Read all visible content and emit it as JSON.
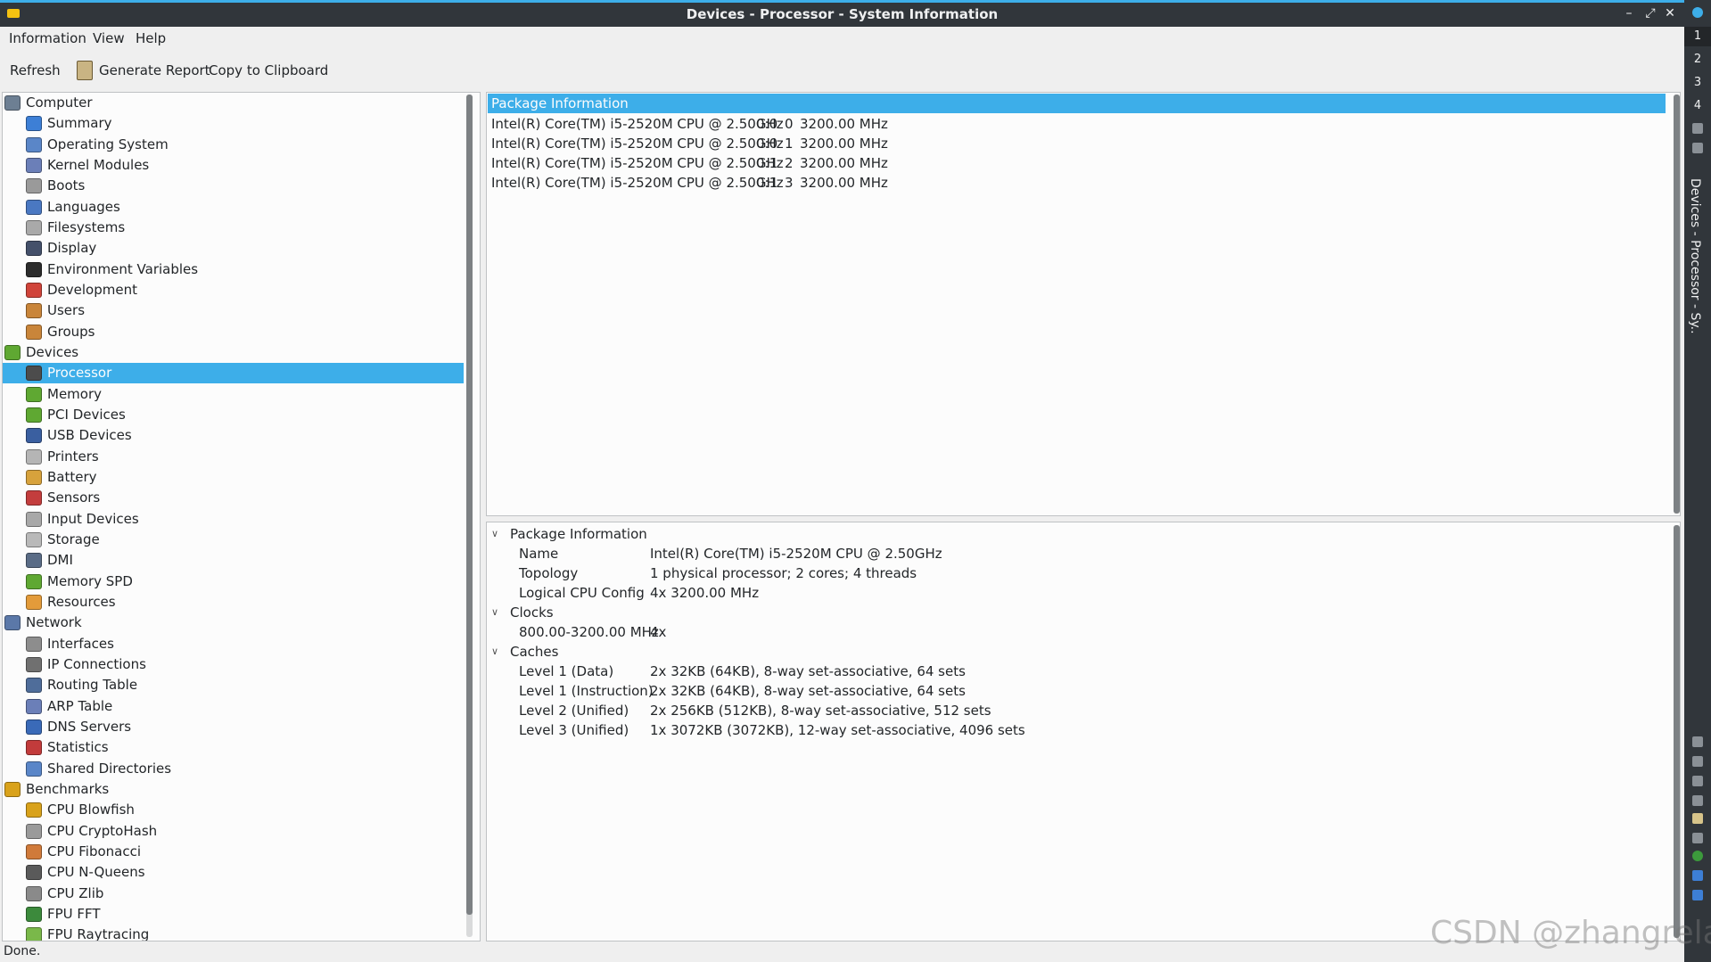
{
  "window": {
    "title": "Devices - Processor - System Information"
  },
  "panel": {
    "desktops": [
      "1",
      "2",
      "3",
      "4"
    ],
    "task_text": "Devices - Processor - Sy..."
  },
  "menu": {
    "items": [
      "Information",
      "View",
      "Help"
    ]
  },
  "toolbar": {
    "refresh": "Refresh",
    "report": "Generate Report",
    "copy": "Copy to Clipboard"
  },
  "tree": [
    {
      "label": "Computer",
      "level": 0,
      "icon": "computer-icon",
      "color": "#6d7f93"
    },
    {
      "label": "Summary",
      "level": 1,
      "icon": "info-icon",
      "color": "#3d7fd6"
    },
    {
      "label": "Operating System",
      "level": 1,
      "icon": "gear-icon",
      "color": "#5a86c8"
    },
    {
      "label": "Kernel Modules",
      "level": 1,
      "icon": "diamond-icon",
      "color": "#6b7fb8"
    },
    {
      "label": "Boots",
      "level": 1,
      "icon": "power-icon",
      "color": "#9a9a9a"
    },
    {
      "label": "Languages",
      "level": 1,
      "icon": "flag-icon",
      "color": "#4a78c2"
    },
    {
      "label": "Filesystems",
      "level": 1,
      "icon": "drive-icon",
      "color": "#a9a9a9"
    },
    {
      "label": "Display",
      "level": 1,
      "icon": "monitor-icon",
      "color": "#44506a"
    },
    {
      "label": "Environment Variables",
      "level": 1,
      "icon": "terminal-icon",
      "color": "#2c2c2c"
    },
    {
      "label": "Development",
      "level": 1,
      "icon": "toolbox-icon",
      "color": "#d0443a"
    },
    {
      "label": "Users",
      "level": 1,
      "icon": "user-icon",
      "color": "#c9853a"
    },
    {
      "label": "Groups",
      "level": 1,
      "icon": "users-icon",
      "color": "#c9853a"
    },
    {
      "label": "Devices",
      "level": 0,
      "icon": "board-icon",
      "color": "#5fa832"
    },
    {
      "label": "Processor",
      "level": 1,
      "icon": "cpu-icon",
      "color": "#4c4c4c",
      "selected": true
    },
    {
      "label": "Memory",
      "level": 1,
      "icon": "memory-icon",
      "color": "#5fa832"
    },
    {
      "label": "PCI Devices",
      "level": 1,
      "icon": "pci-icon",
      "color": "#5fa832"
    },
    {
      "label": "USB Devices",
      "level": 1,
      "icon": "usb-icon",
      "color": "#3a5fa0"
    },
    {
      "label": "Printers",
      "level": 1,
      "icon": "printer-icon",
      "color": "#b5b5b5"
    },
    {
      "label": "Battery",
      "level": 1,
      "icon": "battery-icon",
      "color": "#d7a23c"
    },
    {
      "label": "Sensors",
      "level": 1,
      "icon": "thermometer-icon",
      "color": "#c33d3d"
    },
    {
      "label": "Input Devices",
      "level": 1,
      "icon": "keyboard-icon",
      "color": "#a8a8a8"
    },
    {
      "label": "Storage",
      "level": 1,
      "icon": "storage-icon",
      "color": "#b9b9b9"
    },
    {
      "label": "DMI",
      "level": 1,
      "icon": "dmi-icon",
      "color": "#5a6c86"
    },
    {
      "label": "Memory SPD",
      "level": 1,
      "icon": "memory-spd-icon",
      "color": "#5fa832"
    },
    {
      "label": "Resources",
      "level": 1,
      "icon": "resources-icon",
      "color": "#e39b3a"
    },
    {
      "label": "Network",
      "level": 0,
      "icon": "network-icon",
      "color": "#5b78a8"
    },
    {
      "label": "Interfaces",
      "level": 1,
      "icon": "interfaces-icon",
      "color": "#8d8d8d"
    },
    {
      "label": "IP Connections",
      "level": 1,
      "icon": "ip-icon",
      "color": "#707070"
    },
    {
      "label": "Routing Table",
      "level": 1,
      "icon": "routing-icon",
      "color": "#4f6d9a"
    },
    {
      "label": "ARP Table",
      "level": 1,
      "icon": "arp-icon",
      "color": "#6b7fb8"
    },
    {
      "label": "DNS Servers",
      "level": 1,
      "icon": "globe-icon",
      "color": "#3a6ab8"
    },
    {
      "label": "Statistics",
      "level": 1,
      "icon": "stats-icon",
      "color": "#c23b3b"
    },
    {
      "label": "Shared Directories",
      "level": 1,
      "icon": "shared-icon",
      "color": "#5a86c8"
    },
    {
      "label": "Benchmarks",
      "level": 0,
      "icon": "benchmark-icon",
      "color": "#d9a21b"
    },
    {
      "label": "CPU Blowfish",
      "level": 1,
      "icon": "blowfish-icon",
      "color": "#d9a21b"
    },
    {
      "label": "CPU CryptoHash",
      "level": 1,
      "icon": "crypto-icon",
      "color": "#9a9a9a"
    },
    {
      "label": "CPU Fibonacci",
      "level": 1,
      "icon": "fibonacci-icon",
      "color": "#d07a3a"
    },
    {
      "label": "CPU N-Queens",
      "level": 1,
      "icon": "queens-icon",
      "color": "#5a5a5a"
    },
    {
      "label": "CPU Zlib",
      "level": 1,
      "icon": "zlib-icon",
      "color": "#8a8a8a"
    },
    {
      "label": "FPU FFT",
      "level": 1,
      "icon": "fft-icon",
      "color": "#3c8a3c"
    },
    {
      "label": "FPU Raytracing",
      "level": 1,
      "icon": "raytracing-icon",
      "color": "#7ab84a"
    }
  ],
  "top_list": {
    "header": "Package Information",
    "rows": [
      {
        "model": "Intel(R) Core(TM) i5-2520M CPU @ 2.50GHz",
        "topo": "0:0",
        "id": "0",
        "freq": "3200.00 MHz"
      },
      {
        "model": "Intel(R) Core(TM) i5-2520M CPU @ 2.50GHz",
        "topo": "0:0",
        "id": "1",
        "freq": "3200.00 MHz"
      },
      {
        "model": "Intel(R) Core(TM) i5-2520M CPU @ 2.50GHz",
        "topo": "0:1",
        "id": "2",
        "freq": "3200.00 MHz"
      },
      {
        "model": "Intel(R) Core(TM) i5-2520M CPU @ 2.50GHz",
        "topo": "0:1",
        "id": "3",
        "freq": "3200.00 MHz"
      }
    ]
  },
  "details": {
    "groups": [
      {
        "title": "Package Information",
        "rows": [
          {
            "key": "Name",
            "value": "Intel(R) Core(TM) i5-2520M CPU @ 2.50GHz"
          },
          {
            "key": "Topology",
            "value": "1 physical processor; 2 cores; 4 threads"
          },
          {
            "key": "Logical CPU Config",
            "value": "4x 3200.00 MHz"
          }
        ]
      },
      {
        "title": "Clocks",
        "rows": [
          {
            "key": "800.00-3200.00 MHz",
            "value": "4x"
          }
        ]
      },
      {
        "title": "Caches",
        "rows": [
          {
            "key": "Level 1 (Data)",
            "value": "2x 32KB (64KB), 8-way set-associative, 64 sets"
          },
          {
            "key": "Level 1 (Instruction)",
            "value": "2x 32KB (64KB), 8-way set-associative, 64 sets"
          },
          {
            "key": "Level 2 (Unified)",
            "value": "2x 256KB (512KB), 8-way set-associative, 512 sets"
          },
          {
            "key": "Level 3 (Unified)",
            "value": "1x 3072KB (3072KB), 12-way set-associative, 4096 sets"
          }
        ]
      }
    ]
  },
  "status": "Done.",
  "watermark": "CSDN @zhangrelay"
}
